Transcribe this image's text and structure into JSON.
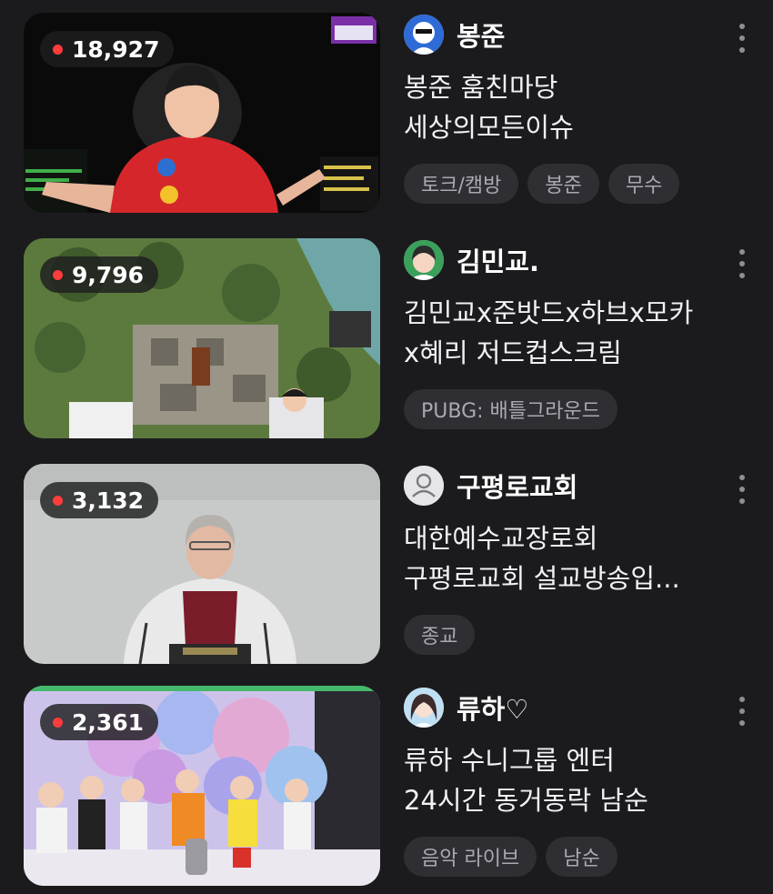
{
  "streams": [
    {
      "viewers": "18,927",
      "channel": "봉준",
      "title_lines": [
        "봉준 훔친마당",
        "세상의모든이슈"
      ],
      "tags": [
        "토크/캠방",
        "봉준",
        "무수"
      ]
    },
    {
      "viewers": "9,796",
      "channel": "김민교.",
      "title_lines": [
        "김민교x준밧드x하브x모카",
        "x혜리 저드컵스크림"
      ],
      "tags": [
        "PUBG: 배틀그라운드"
      ]
    },
    {
      "viewers": "3,132",
      "channel": "구평로교회",
      "title_lines": [
        "대한예수교장로회",
        "구평로교회 설교방송입..."
      ],
      "tags": [
        "종교"
      ]
    },
    {
      "viewers": "2,361",
      "channel": "류하♡",
      "title_lines": [
        "류하 수니그룹 엔터",
        "24시간 동거동락 남순"
      ],
      "tags": [
        "음악 라이브",
        "남순"
      ]
    }
  ],
  "icons": {
    "live": "live-dot-icon",
    "more": "more-vertical-icon",
    "default_avatar": "person-placeholder-icon"
  },
  "colors": {
    "background": "#1b1b1e",
    "live_red": "#ff3c3c",
    "tag_bg": "#2e2e33",
    "tag_text": "#a9a9b1"
  }
}
